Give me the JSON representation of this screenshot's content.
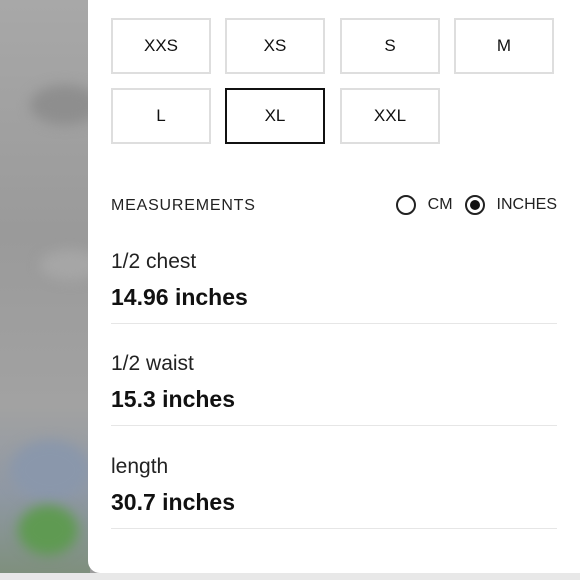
{
  "sizes": {
    "options": [
      "XXS",
      "XS",
      "S",
      "M",
      "L",
      "XL",
      "XXL"
    ],
    "selected": "XL"
  },
  "measurements": {
    "title": "MEASUREMENTS",
    "units": {
      "cm_label": "CM",
      "inches_label": "INCHES",
      "selected": "INCHES"
    },
    "rows": [
      {
        "label": "1/2 chest",
        "value": "14.96 inches"
      },
      {
        "label": "1/2 waist",
        "value": "15.3 inches"
      },
      {
        "label": "length",
        "value": "30.7 inches"
      }
    ]
  }
}
